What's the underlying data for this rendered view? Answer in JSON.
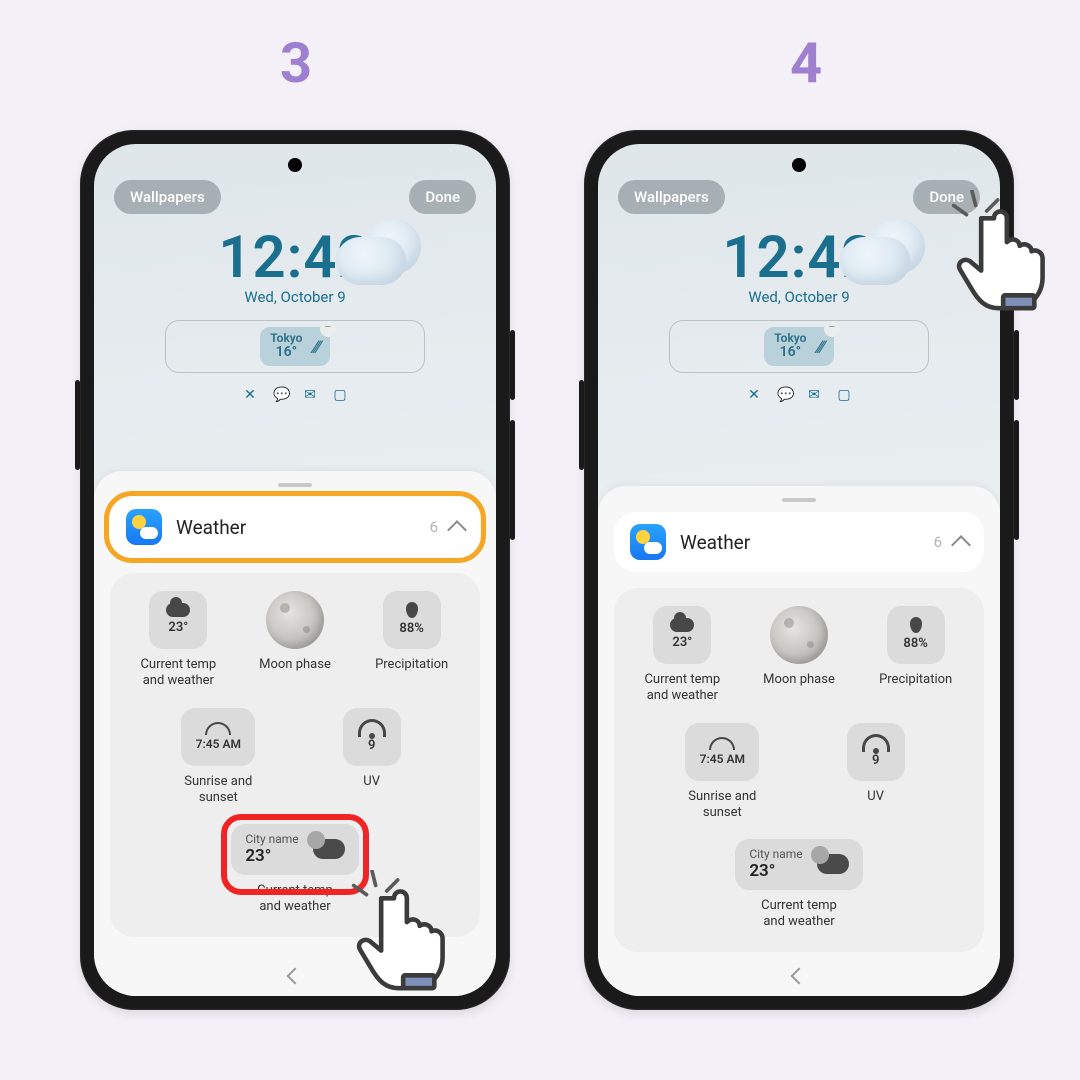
{
  "steps": {
    "left": "3",
    "right": "4"
  },
  "topbar": {
    "wallpapers": "Wallpapers",
    "done": "Done"
  },
  "clock": {
    "time": "12:42",
    "date": "Wed, October 9"
  },
  "mini_widget": {
    "city": "Tokyo",
    "temp": "16°"
  },
  "sheet": {
    "title": "Weather",
    "count": "6",
    "items": {
      "current": {
        "value": "23°",
        "label": "Current temp\nand weather"
      },
      "moon": {
        "label": "Moon phase"
      },
      "precip": {
        "value": "88%",
        "label": "Precipitation"
      },
      "sunrise": {
        "value": "7:45 AM",
        "label": "Sunrise and\nsunset"
      },
      "uv": {
        "value": "9",
        "label": "UV"
      },
      "city": {
        "city_label": "City name",
        "temp": "23°",
        "label": "Current temp\nand weather"
      }
    }
  }
}
